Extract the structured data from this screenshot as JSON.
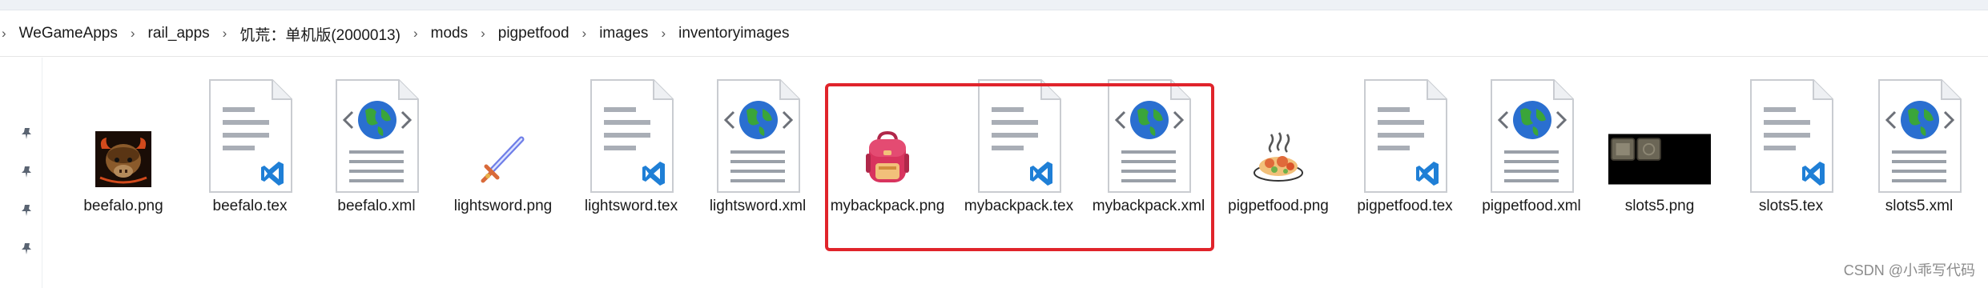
{
  "breadcrumb": [
    "WeGameApps",
    "rail_apps",
    "饥荒：单机版(2000013)",
    "mods",
    "pigpetfood",
    "images",
    "inventoryimages"
  ],
  "breadcrumb_separator": "›",
  "files": [
    {
      "name": "beefalo.png",
      "kind": "png",
      "icon": "beefalo-icon"
    },
    {
      "name": "beefalo.tex",
      "kind": "tex",
      "icon": "tex-file-icon"
    },
    {
      "name": "beefalo.xml",
      "kind": "xml",
      "icon": "xml-file-icon"
    },
    {
      "name": "lightsword.png",
      "kind": "png",
      "icon": "lightsword-icon"
    },
    {
      "name": "lightsword.tex",
      "kind": "tex",
      "icon": "tex-file-icon"
    },
    {
      "name": "lightsword.xml",
      "kind": "xml",
      "icon": "xml-file-icon"
    },
    {
      "name": "mybackpack.png",
      "kind": "png",
      "icon": "backpack-icon"
    },
    {
      "name": "mybackpack.tex",
      "kind": "tex",
      "icon": "tex-file-icon"
    },
    {
      "name": "mybackpack.xml",
      "kind": "xml",
      "icon": "xml-file-icon"
    },
    {
      "name": "pigpetfood.png",
      "kind": "png",
      "icon": "food-icon"
    },
    {
      "name": "pigpetfood.tex",
      "kind": "tex",
      "icon": "tex-file-icon"
    },
    {
      "name": "pigpetfood.xml",
      "kind": "xml",
      "icon": "xml-file-icon"
    },
    {
      "name": "slots5.png",
      "kind": "png",
      "icon": "slots-icon"
    },
    {
      "name": "slots5.tex",
      "kind": "tex",
      "icon": "tex-file-icon"
    },
    {
      "name": "slots5.xml",
      "kind": "xml",
      "icon": "xml-file-icon"
    }
  ],
  "watermark": "CSDN @小乖写代码",
  "colors": {
    "highlight": "#e0242b",
    "vscode_blue": "#1f7fd6",
    "globe_blue": "#2a6fd0",
    "globe_green": "#3aa53a"
  }
}
